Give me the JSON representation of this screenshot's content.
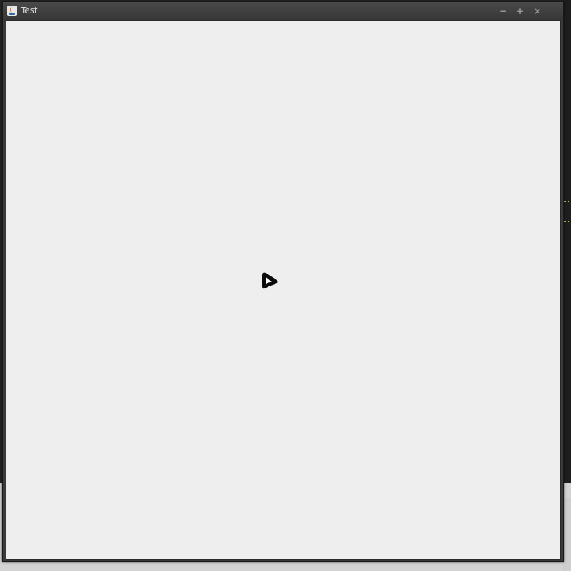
{
  "window": {
    "title": "Test",
    "icon": "java-coffee-icon",
    "controls": {
      "minimize": "−",
      "maximize": "+",
      "close": "×"
    }
  },
  "cursor": {
    "icon": "mouse-pointer-icon"
  },
  "colors": {
    "titlebar": "#3c3c3c",
    "content": "#eeeeee",
    "title_text": "#d8d8d8"
  }
}
